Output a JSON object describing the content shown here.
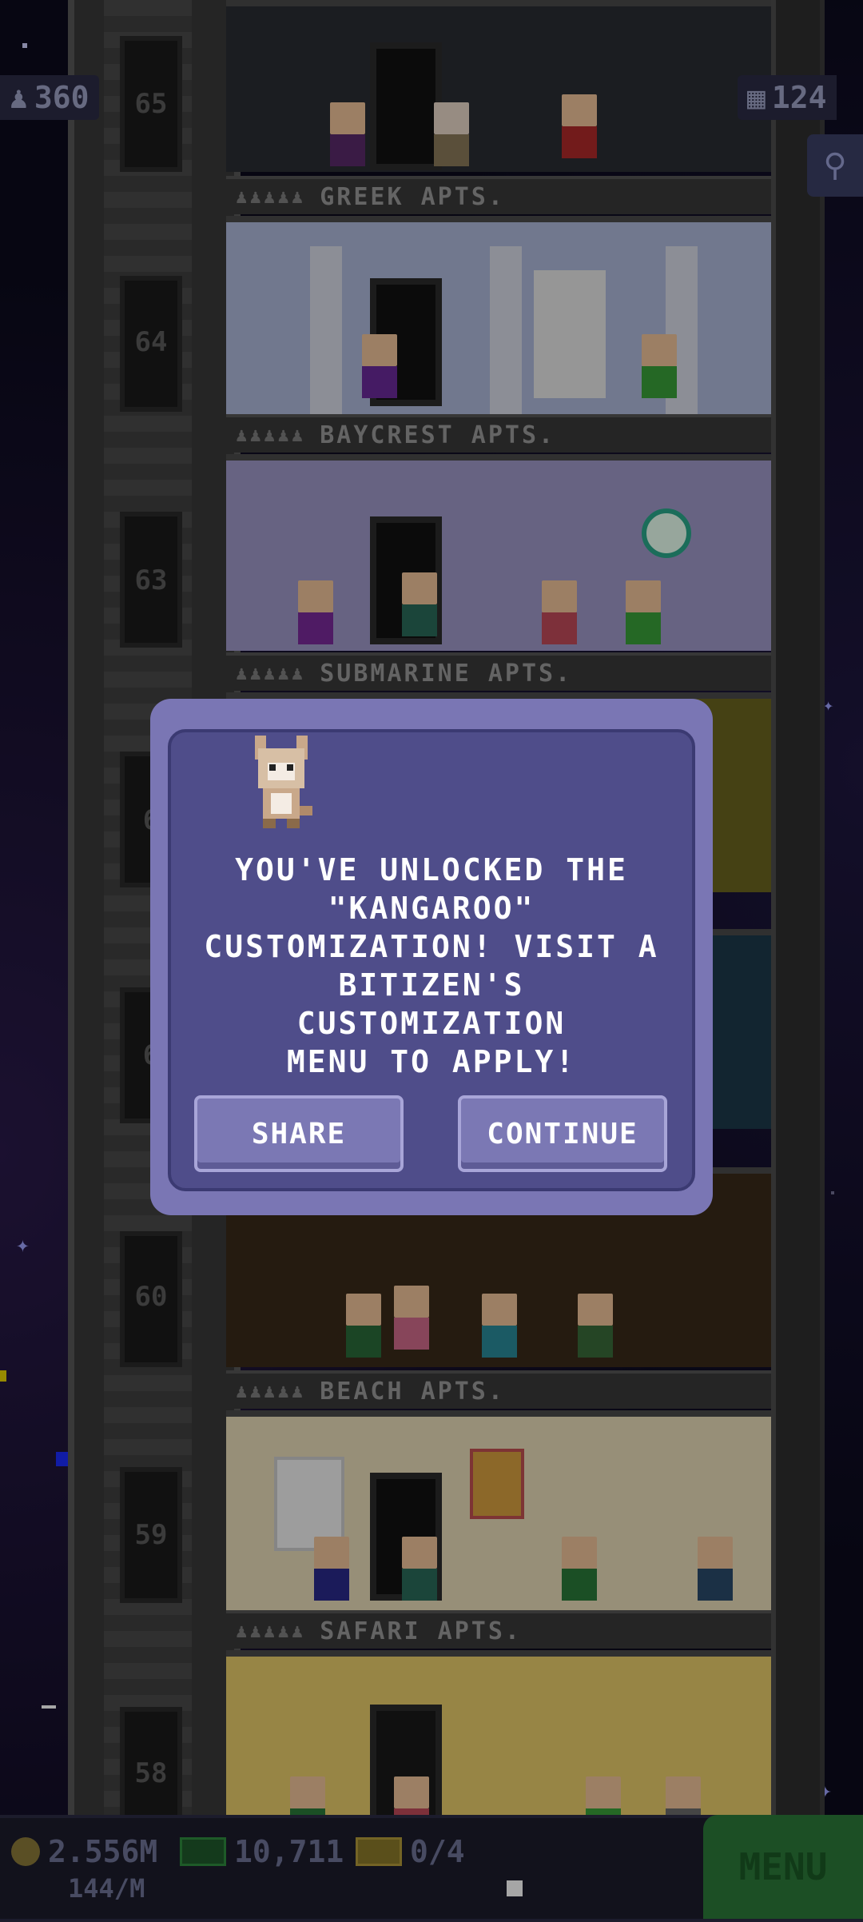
{
  "hud": {
    "population": "360",
    "floors": "124"
  },
  "floors": [
    {
      "number": "65",
      "name": "GREEK APTS."
    },
    {
      "number": "64",
      "name": "BAYCREST APTS."
    },
    {
      "number": "63",
      "name": "SUBMARINE APTS."
    },
    {
      "number": "60",
      "name": "BEACH APTS."
    },
    {
      "number": "59",
      "name": "SAFARI APTS."
    },
    {
      "number": "58",
      "name": ""
    }
  ],
  "partial_floor_numbers": [
    "6",
    "6"
  ],
  "dialog": {
    "message_lines": [
      "YOU'VE UNLOCKED THE",
      "\"KANGAROO\"",
      "CUSTOMIZATION! VISIT A",
      "BITIZEN'S CUSTOMIZATION",
      "MENU TO APPLY!"
    ],
    "share_label": "SHARE",
    "continue_label": "CONTINUE",
    "icon": "kangaroo-costume-icon"
  },
  "bottom_bar": {
    "coins": "2.556M",
    "coins_rate": "144/M",
    "bux": "10,711",
    "tickets": "0/4",
    "menu_label": "MENU"
  },
  "colors": {
    "dialog_bg": "#4f4d8a",
    "dialog_border": "#7a76b4",
    "menu_green": "#2b7a3a"
  }
}
